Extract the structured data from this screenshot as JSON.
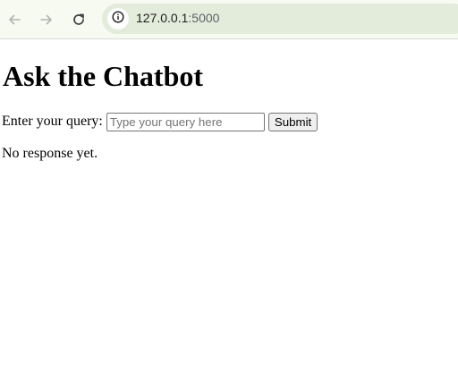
{
  "browser": {
    "url_host": "127.0.0.1",
    "url_port": ":5000",
    "icons": {
      "back": "arrow-left-icon",
      "forward": "arrow-right-icon",
      "reload": "reload-icon",
      "site_info": "info-icon"
    }
  },
  "page": {
    "title": "Ask the Chatbot",
    "query_label": "Enter your query:",
    "query_placeholder": "Type your query here",
    "query_value": "",
    "submit_label": "Submit",
    "response_text": "No response yet."
  },
  "colors": {
    "toolbar_bg": "#f7faf1",
    "omnibox_bg": "#e3ebdb",
    "icon_inactive": "#b0b5ad",
    "icon_active": "#3c4043"
  }
}
